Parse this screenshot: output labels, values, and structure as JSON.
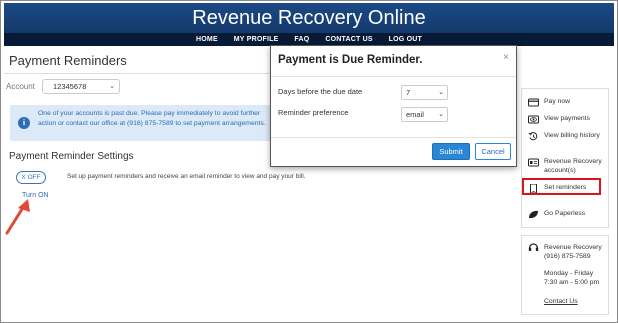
{
  "header": {
    "title": "Revenue Recovery Online"
  },
  "nav": {
    "items": [
      "HOME",
      "MY PROFILE",
      "FAQ",
      "CONTACT US",
      "LOG OUT"
    ]
  },
  "page": {
    "title": "Payment Reminders"
  },
  "account": {
    "label": "Account",
    "value": "12345678"
  },
  "alert": {
    "text": "One of your accounts is past due. Please pay immediately to avoid further action or contact our office at (916) 875-7589 to set payment arrangements."
  },
  "settings": {
    "title": "Payment Reminder Settings",
    "toggle_label": "X OFF",
    "description": "Set up payment reminders and receive an email reminder to view and pay your bill.",
    "turn_on": "Turn ON"
  },
  "modal": {
    "title": "Payment is Due Reminder.",
    "close": "×",
    "fields": [
      {
        "label": "Days before the due date",
        "value": "7"
      },
      {
        "label": "Reminder preference",
        "value": "email"
      }
    ],
    "submit": "Submit",
    "cancel": "Cancel"
  },
  "sidebar": {
    "items": [
      {
        "label": "Pay now",
        "icon": "card-icon"
      },
      {
        "label": "View payments",
        "icon": "eye-icon"
      },
      {
        "label": "View billing history",
        "icon": "history-icon"
      },
      {
        "label": "Revenue Recovery account(s)",
        "icon": "id-card-icon"
      },
      {
        "label": "Set reminders",
        "icon": "mobile-icon"
      },
      {
        "label": "Go Paperless",
        "icon": "leaf-icon"
      }
    ]
  },
  "contact": {
    "name": "Revenue Recovery",
    "phone": "(916) 875-7589",
    "days": "Monday - Friday",
    "hours": "7:30 am - 5:00 pm",
    "link": "Contact Us"
  },
  "colors": {
    "banner": "#1b4a86",
    "navbar": "#071a36",
    "accent": "#2a87d6",
    "highlight": "#d8141c"
  }
}
